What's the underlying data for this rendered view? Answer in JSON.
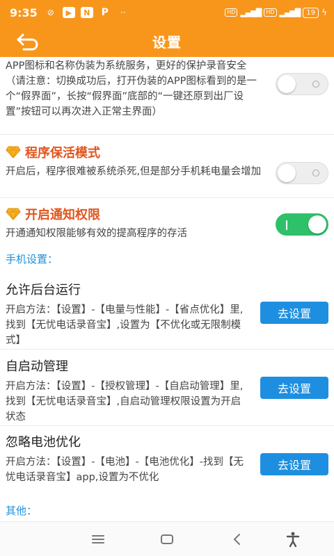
{
  "status_bar": {
    "time": "9:35",
    "network_left_1": "HD",
    "network_left_2": "HD",
    "battery": "19"
  },
  "app_bar": {
    "title": "设置"
  },
  "disguise": {
    "description": "APP图标和名称伪装为系统服务，更好的保护录音安全（请注意：切换成功后，打开伪装的APP图标看到的是一个“假界面”，长按“假界面”底部的“一键还原到出厂设置”按钮可以再次进入正常主界面）",
    "enabled": false
  },
  "keep_alive": {
    "title": "程序保活模式",
    "description": "开启后，程序很难被系统杀死,但是部分手机耗电量会增加",
    "enabled": false
  },
  "notification": {
    "title": "开启通知权限",
    "description": "开通通知权限能够有效的提高程序的存活",
    "enabled": true
  },
  "phone_settings_header": "手机设置：",
  "permissions": [
    {
      "title": "允许后台运行",
      "description": "开启方法：【设置】-【电量与性能】-【省点优化】里,找到【无忧电话录音宝】,设置为【不优化或无限制模式】",
      "button": "去设置"
    },
    {
      "title": "自启动管理",
      "description": "开启方法：【设置】-【授权管理】-【自启动管理】里,找到【无忧电话录音宝】,自启动管理权限设置为开启状态",
      "button": "去设置"
    },
    {
      "title": "忽略电池优化",
      "description": "开启方法：【设置】-【电池】-【电池优化】-找到【无忧电话录音宝】app,设置为不优化",
      "button": "去设置"
    }
  ],
  "other_header": "其他：",
  "colors": {
    "accent": "#f8961c",
    "button": "#1e8fe0",
    "toggle_on": "#2fc06a",
    "feature_title": "#e2541c",
    "section_header": "#1e90d8"
  }
}
